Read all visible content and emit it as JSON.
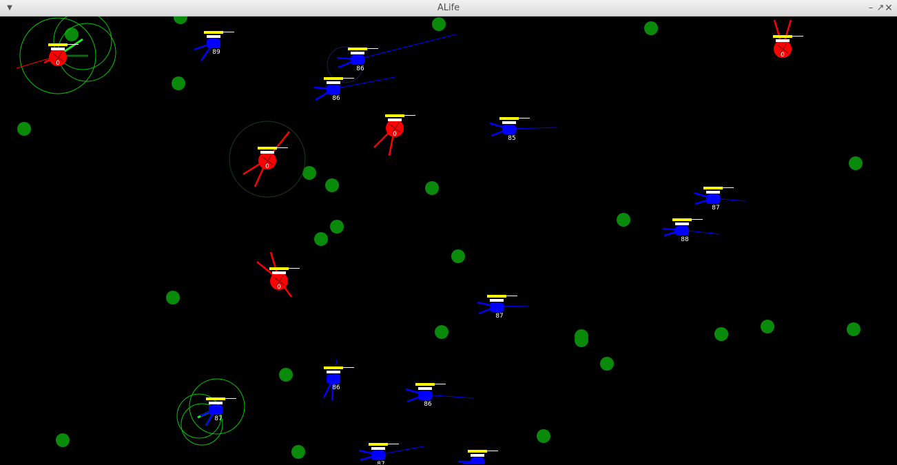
{
  "window": {
    "title": "ALife",
    "menu_icon": "chevron-down-icon",
    "minimize_icon": "minimize-icon",
    "maximize_icon": "maximize-icon",
    "close_icon": "close-icon"
  },
  "colors": {
    "background": "#000000",
    "food": "#0a8a0a",
    "predator": "#ff0000",
    "prey": "#0000ff",
    "energy_bar": "#ffff00",
    "health_bar": "#ffffff",
    "sensor_range": "#00cc00"
  },
  "world": {
    "food": [
      {
        "id": "f1"
      },
      {
        "id": "f2"
      },
      {
        "id": "f3"
      },
      {
        "id": "f4"
      },
      {
        "id": "f5"
      },
      {
        "id": "f6"
      },
      {
        "id": "f7"
      },
      {
        "id": "f8"
      },
      {
        "id": "f9"
      },
      {
        "id": "f10"
      },
      {
        "id": "f11"
      },
      {
        "id": "f12"
      },
      {
        "id": "f13"
      },
      {
        "id": "f14"
      },
      {
        "id": "f15"
      },
      {
        "id": "f16"
      },
      {
        "id": "f17"
      },
      {
        "id": "f18"
      },
      {
        "id": "f19"
      },
      {
        "id": "f20"
      },
      {
        "id": "f21"
      },
      {
        "id": "f22"
      },
      {
        "id": "f23"
      },
      {
        "id": "f24"
      },
      {
        "id": "f25"
      },
      {
        "id": "f26"
      },
      {
        "id": "f27"
      }
    ],
    "predators": [
      {
        "id": "p1",
        "label": "0"
      },
      {
        "id": "p2",
        "label": "0"
      },
      {
        "id": "p3",
        "label": "0"
      },
      {
        "id": "p4",
        "label": "0"
      },
      {
        "id": "p5",
        "label": "0"
      }
    ],
    "prey": [
      {
        "id": "q1",
        "label": "89"
      },
      {
        "id": "q2",
        "label": "86"
      },
      {
        "id": "q3",
        "label": "86"
      },
      {
        "id": "q4",
        "label": "85"
      },
      {
        "id": "q5",
        "label": "87"
      },
      {
        "id": "q6",
        "label": "88"
      },
      {
        "id": "q7",
        "label": "87"
      },
      {
        "id": "q8",
        "label": "86"
      },
      {
        "id": "q9",
        "label": "86"
      },
      {
        "id": "q10",
        "label": "87"
      },
      {
        "id": "q11",
        "label": "87"
      },
      {
        "id": "q12",
        "label": ""
      }
    ]
  }
}
